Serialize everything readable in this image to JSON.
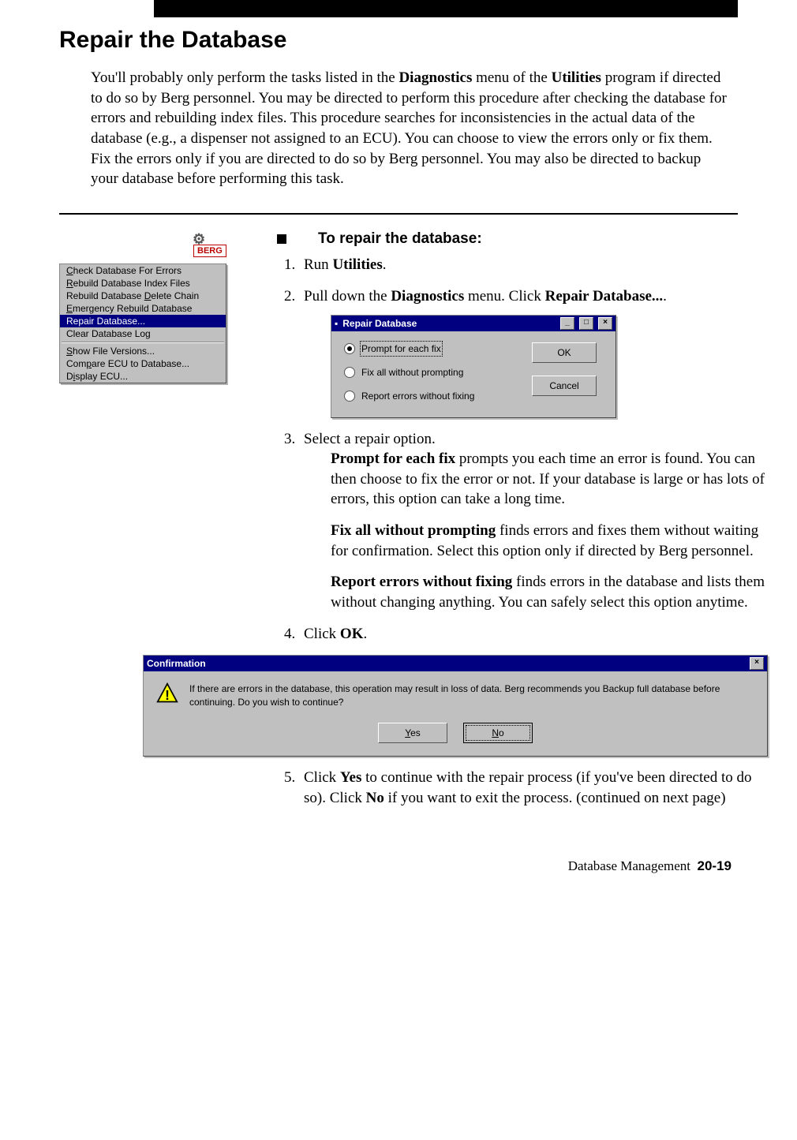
{
  "title": "Repair the Database",
  "intro_parts": {
    "p1": "You'll probably only perform the tasks listed in the ",
    "b1": "Diagnostics",
    "p2": " menu of the ",
    "b2": "Utilities",
    "p3": " program if directed to do so by Berg personnel. You may be directed to perform this procedure after checking the database for errors and rebuilding index files. This procedure searches for inconsistencies in the actual data of the database (e.g., a dispenser not assigned to an ECU). You can choose to view the errors only or fix them. Fix the errors only if you are directed to do so by Berg personnel. You may also be directed to backup your database before performing this task."
  },
  "section_lead": "To repair the database:",
  "berg_logo_text": "BERG",
  "ctx_menu": {
    "items": [
      {
        "pre": "",
        "u": "C",
        "post": "heck Database For Errors",
        "sel": false
      },
      {
        "pre": "",
        "u": "R",
        "post": "ebuild Database Index Files",
        "sel": false
      },
      {
        "pre": "Rebuild Database ",
        "u": "D",
        "post": "elete Chain",
        "sel": false
      },
      {
        "pre": "",
        "u": "E",
        "post": "mergency Rebuild Database",
        "sel": false
      },
      {
        "pre": "Repair Database...",
        "u": "",
        "post": "",
        "sel": true
      },
      {
        "pre": "Clear Database Log",
        "u": "",
        "post": "",
        "sel": false
      }
    ],
    "items2": [
      {
        "pre": "",
        "u": "S",
        "post": "how File Versions...",
        "sel": false
      },
      {
        "pre": "Com",
        "u": "p",
        "post": "are ECU to Database...",
        "sel": false
      },
      {
        "pre": "D",
        "u": "i",
        "post": "splay ECU...",
        "sel": false
      }
    ]
  },
  "steps": {
    "s1": {
      "t1": "Run ",
      "b": "Utilities",
      "t2": "."
    },
    "s2": {
      "t1": "Pull down the ",
      "b1": "Diagnostics",
      "t2": " menu. Click ",
      "b2": "Repair Database...",
      "t3": "."
    },
    "s3": {
      "t1": "Select a repair option."
    },
    "s4": {
      "t1": "Click ",
      "b": "OK",
      "t2": "."
    },
    "s5": {
      "t1": "Click ",
      "b1": "Yes",
      "t2": " to continue with the repair process (if you've been directed to do so). Click ",
      "b2": "No",
      "t3": " if you want to exit the process. (continued on next page)"
    }
  },
  "opt_prompt": {
    "b": "Prompt for each fix",
    "t": " prompts you each time an error is found. You can then choose to fix the error or not. If your database is large or has lots of errors, this option can take a long time."
  },
  "opt_fixall": {
    "b": "Fix all without prompting",
    "t": " finds errors and fixes them without waiting for confirmation. Select this option only if directed by Berg personnel."
  },
  "opt_report": {
    "b": "Report errors without fixing",
    "t": " finds errors in the database and lists them without changing anything. You can safely select this option anytime."
  },
  "dlg_repair": {
    "title": "Repair Database",
    "radios": [
      "Prompt for each fix",
      "Fix all without prompting",
      "Report errors without fixing"
    ],
    "buttons": {
      "ok": "OK",
      "cancel": "Cancel"
    }
  },
  "dlg_confirm": {
    "title": "Confirmation",
    "message": "If there are errors in the database, this operation may result in loss of data. Berg recommends you Backup full database before continuing. Do you wish to continue?",
    "yes_u": "Y",
    "yes_r": "es",
    "no_u": "N",
    "no_r": "o"
  },
  "footer": {
    "section": "Database Management",
    "page": "20-19"
  }
}
